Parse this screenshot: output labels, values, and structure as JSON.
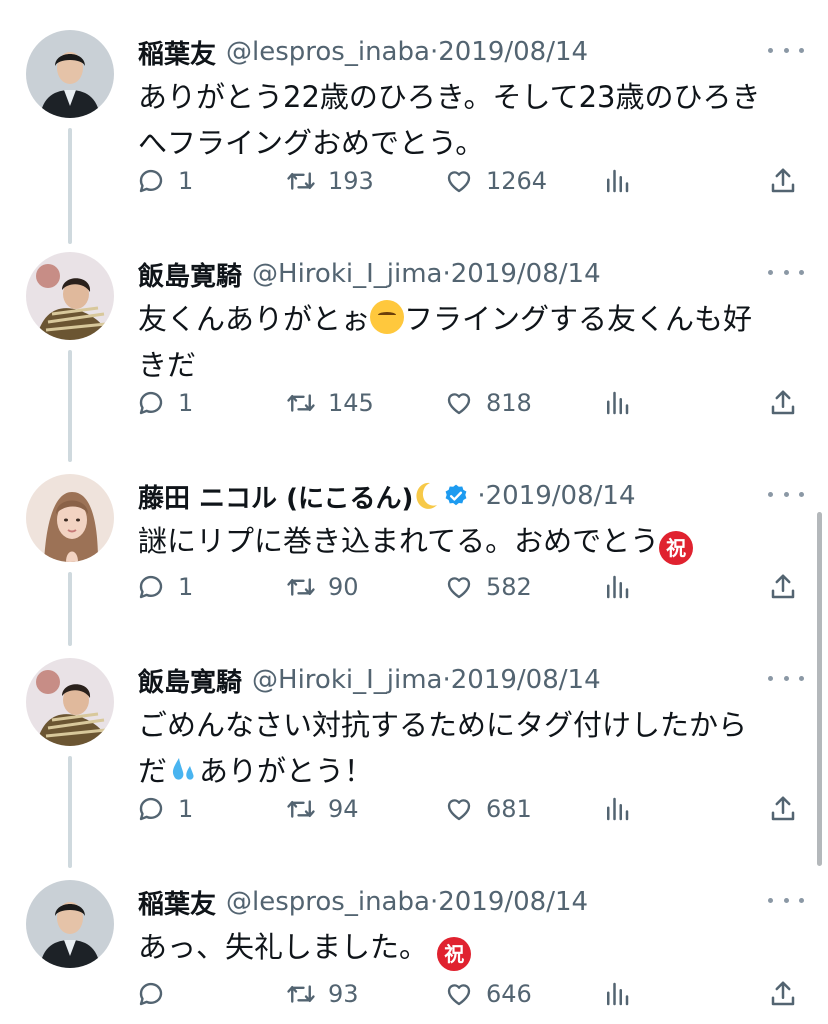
{
  "colors": {
    "text": "#0f1419",
    "muted": "#536471",
    "verified": "#1d9bf0",
    "badge_red": "#e0222f",
    "thread_line": "#cfd9de"
  },
  "tweets": [
    {
      "name": "稲葉友",
      "handle": "@lespros_inaba",
      "sep": "·",
      "date": "2019/08/14",
      "lines": [
        "ありがとう22歳のひろき。そして23歳のひろき",
        "へフライングおめでとう。"
      ],
      "reply": "1",
      "retweet": "193",
      "like": "1264",
      "avatar": "avatar-inaba"
    },
    {
      "name": "飯島寛騎",
      "handle": "@Hiroki_I_jima",
      "sep": "·",
      "date": "2019/08/14",
      "lines": [
        "友くんありがとぉ",
        "フライングする友くんも好",
        "きだ"
      ],
      "emoji": "kissing-face-emoji",
      "reply": "1",
      "retweet": "145",
      "like": "818",
      "avatar": "avatar-iijima"
    },
    {
      "name": "藤田 ニコル (にこるん)",
      "handle": "",
      "sep": "·",
      "date": "2019/08/14",
      "lines": [
        "謎にリプに巻き込まれてる。おめでとう",
        "祝"
      ],
      "emoji": "crescent-moon-emoji",
      "reply": "1",
      "retweet": "90",
      "like": "582",
      "avatar": "avatar-fujita"
    },
    {
      "name": "飯島寛騎",
      "handle": "@Hiroki_I_jima",
      "sep": "·",
      "date": "2019/08/14",
      "lines": [
        "ごめんなさい対抗するためにタグ付けしたから",
        "だ",
        "ありがとう！"
      ],
      "emoji": "sweat-droplets-emoji",
      "reply": "1",
      "retweet": "94",
      "like": "681",
      "avatar": "avatar-iijima"
    },
    {
      "name": "稲葉友",
      "handle": "@lespros_inaba",
      "sep": "·",
      "date": "2019/08/14",
      "lines": [
        "あっ、失礼しました。",
        "祝"
      ],
      "reply": "",
      "retweet": "93",
      "like": "646",
      "avatar": "avatar-inaba"
    }
  ],
  "icons": [
    "reply-icon",
    "retweet-icon",
    "like-icon",
    "views-icon",
    "share-icon",
    "more-icon",
    "verified-badge-icon"
  ]
}
